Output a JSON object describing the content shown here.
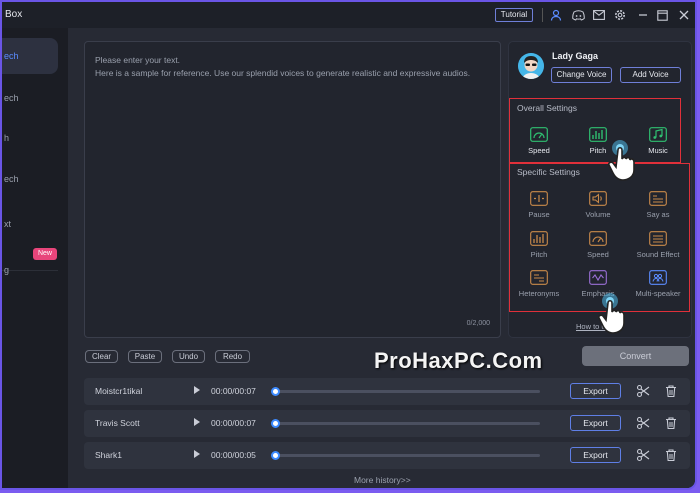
{
  "app": {
    "title": "Box",
    "tutorial": "Tutorial"
  },
  "sidebar": {
    "items": [
      {
        "label": "ech",
        "active": true
      },
      {
        "label": "ech",
        "active": false
      },
      {
        "label": "h",
        "active": false
      },
      {
        "label": "ech",
        "active": false
      },
      {
        "label": "xt",
        "active": false
      },
      {
        "label": "g",
        "active": false
      }
    ],
    "badge": "New"
  },
  "editor": {
    "placeholder_line1": "Please enter your text.",
    "placeholder_line2": "Here is a sample for reference. Use our splendid voices to generate realistic and expressive audios.",
    "counter": "0/2,000"
  },
  "voice": {
    "name": "Lady Gaga",
    "change": "Change Voice",
    "add": "Add Voice"
  },
  "overall": {
    "title": "Overall Settings",
    "items": [
      {
        "label": "Speed",
        "icon": "speed-gauge-icon"
      },
      {
        "label": "Pitch",
        "icon": "pitch-bars-icon"
      },
      {
        "label": "Music",
        "icon": "music-note-icon"
      }
    ]
  },
  "specific": {
    "title": "Specific Settings",
    "items": [
      {
        "label": "Pause",
        "icon": "pause-icon"
      },
      {
        "label": "Volume",
        "icon": "volume-icon"
      },
      {
        "label": "Say as",
        "icon": "say-as-icon"
      },
      {
        "label": "Pitch",
        "icon": "pitch-icon"
      },
      {
        "label": "Speed",
        "icon": "speed-icon"
      },
      {
        "label": "Sound Effect",
        "icon": "sound-effect-icon"
      },
      {
        "label": "Heteronyms",
        "icon": "heteronyms-icon"
      },
      {
        "label": "Emphasis",
        "icon": "emphasis-icon"
      },
      {
        "label": "Multi-speaker",
        "icon": "multi-speaker-icon"
      }
    ]
  },
  "howto": "How to use",
  "edit_buttons": {
    "clear": "Clear",
    "paste": "Paste",
    "undo": "Undo",
    "redo": "Redo"
  },
  "convert": "Convert",
  "watermark": "ProHaxPC.Com",
  "history": {
    "rows": [
      {
        "name": "Moistcr1tikal",
        "time": "00:00/00:07",
        "progress": 0,
        "export": "Export"
      },
      {
        "name": "Travis Scott",
        "time": "00:00/00:07",
        "progress": 0,
        "export": "Export"
      },
      {
        "name": "Shark1",
        "time": "00:00/00:05",
        "progress": 0,
        "export": "Export"
      }
    ],
    "more": "More history>>"
  },
  "colors": {
    "accent": "#5b8cff",
    "overall_icon": "#2fbf71",
    "specific_icon": "#c98a4a",
    "highlight_box": "#e0303a"
  }
}
